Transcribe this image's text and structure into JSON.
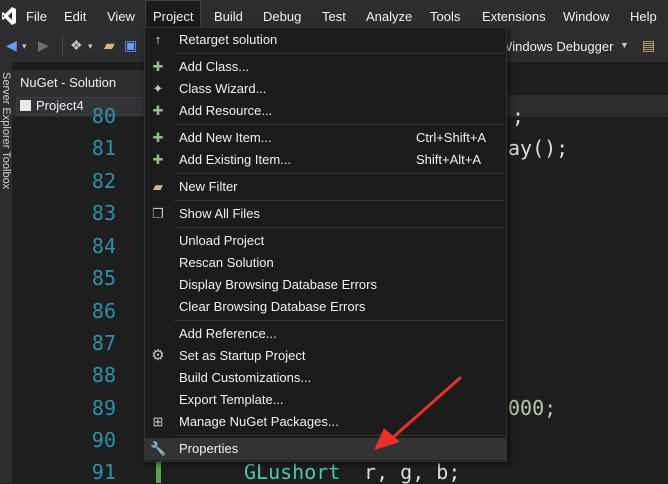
{
  "menubar": {
    "items": [
      "File",
      "Edit",
      "View",
      "Project",
      "Build",
      "Debug",
      "Test",
      "Analyze",
      "Tools",
      "Extensions",
      "Window",
      "Help"
    ],
    "active": "Project"
  },
  "toolbar": {
    "debugger_label": "Windows Debugger"
  },
  "side_panel": {
    "rail_text": "Server Explorer  Toolbox",
    "solution_tab": "NuGet - Solution",
    "project_dropdown": "Project4"
  },
  "editor": {
    "line_numbers": [
      "80",
      "81",
      "82",
      "83",
      "84",
      "85",
      "86",
      "87",
      "88",
      "89",
      "90",
      "91"
    ],
    "fragments": {
      "line80_tail": ";",
      "line81_tail": "ay();",
      "line89_tail": "000;",
      "line91_code_type": "GLushort",
      "line91_code_rest": " r, g, b;"
    }
  },
  "project_menu": {
    "items": [
      {
        "label": "Retarget solution",
        "icon": "up-arrow-icon"
      },
      {
        "label": "Add Class...",
        "icon": "add-class-icon"
      },
      {
        "label": "Class Wizard...",
        "icon": "class-wizard-icon"
      },
      {
        "label": "Add Resource...",
        "icon": "add-resource-icon"
      },
      {
        "label": "Add New Item...",
        "icon": "add-new-item-icon",
        "shortcut": "Ctrl+Shift+A"
      },
      {
        "label": "Add Existing Item...",
        "icon": "add-existing-item-icon",
        "shortcut": "Shift+Alt+A"
      },
      {
        "label": "New Filter",
        "icon": "new-filter-icon"
      },
      {
        "label": "Show All Files",
        "icon": "show-all-files-icon"
      },
      {
        "label": "Unload Project"
      },
      {
        "label": "Rescan Solution"
      },
      {
        "label": "Display Browsing Database Errors"
      },
      {
        "label": "Clear Browsing Database Errors"
      },
      {
        "label": "Add Reference..."
      },
      {
        "label": "Set as Startup Project",
        "icon": "gear-icon"
      },
      {
        "label": "Build Customizations..."
      },
      {
        "label": "Export Template..."
      },
      {
        "label": "Manage NuGet Packages...",
        "icon": "package-icon"
      },
      {
        "label": "Properties",
        "icon": "wrench-icon",
        "highlighted": true
      }
    ]
  },
  "colors": {
    "accent_line_number": "#2b91af",
    "annotation_arrow": "#e8312a",
    "menu_background": "#1b1b1c"
  }
}
